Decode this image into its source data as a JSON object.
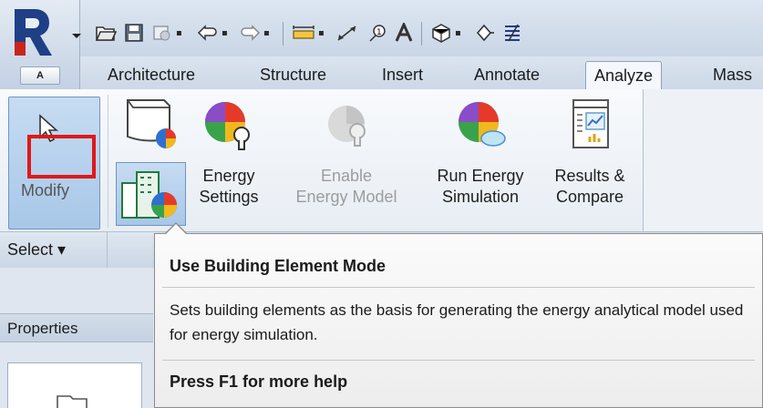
{
  "app": {
    "menu_letter": "A",
    "icon": "revit-logo-icon"
  },
  "quick_access": {
    "tools": [
      "open-icon",
      "save-icon",
      "sync-icon",
      "undo-icon",
      "redo-icon",
      "measure-icon",
      "dimension-icon",
      "tag-icon",
      "text-icon",
      "3d-view-icon",
      "section-icon",
      "thin-lines-icon"
    ]
  },
  "tabs": [
    {
      "label": "Architecture"
    },
    {
      "label": "Structure"
    },
    {
      "label": "Insert"
    },
    {
      "label": "Annotate"
    },
    {
      "label": "Analyze",
      "active": true
    },
    {
      "label": "Mass"
    }
  ],
  "ribbon": {
    "modify_label": "Modify",
    "energy_settings": {
      "line1": "Energy",
      "line2": "Settings"
    },
    "enable_energy_model": {
      "line1": "Enable",
      "line2": "Energy Model"
    },
    "run_energy_simulation": {
      "line1": "Run Energy",
      "line2": "Simulation"
    },
    "results_compare": {
      "line1": "Results &",
      "line2": "Compare"
    },
    "select_label": "Select",
    "select_chevron": "▾"
  },
  "properties": {
    "header": "Properties"
  },
  "tooltip": {
    "title": "Use Building Element Mode",
    "description": "Sets building elements as the basis for generating the energy analytical model used for energy simulation.",
    "help": "Press F1 for more help"
  },
  "colors": {
    "accent_blue": "#a8c7e8",
    "highlight_red": "#e01818"
  }
}
